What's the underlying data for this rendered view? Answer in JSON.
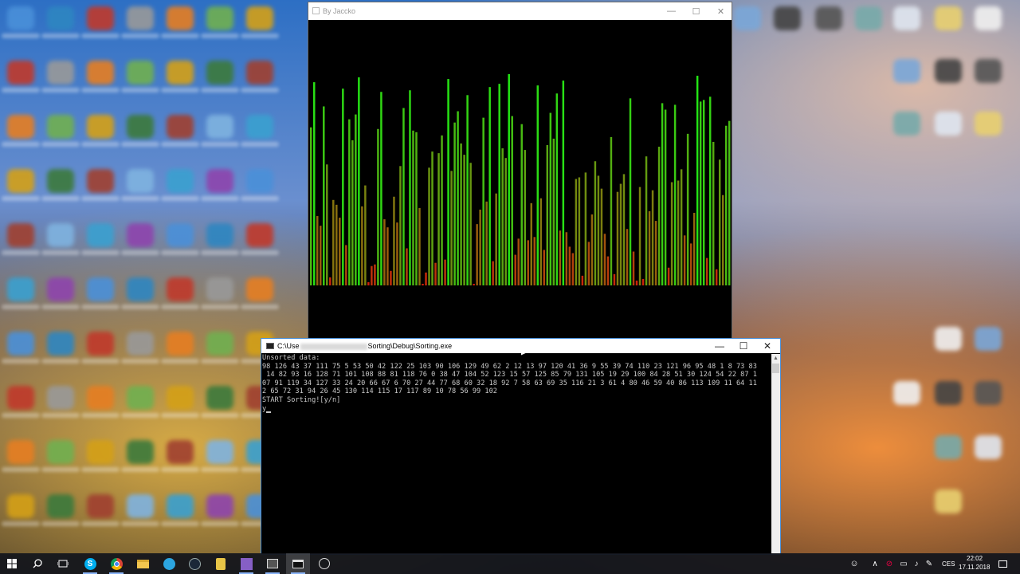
{
  "viz_window": {
    "title": "By Jaccko",
    "values": [
      98,
      126,
      43,
      37,
      111,
      75,
      5,
      53,
      50,
      42,
      122,
      25,
      103,
      90,
      106,
      129,
      49,
      62,
      2,
      12,
      13,
      97,
      120,
      41,
      36,
      9,
      55,
      39,
      74,
      110,
      23,
      121,
      96,
      95,
      48,
      1,
      8,
      73,
      83,
      14,
      82,
      93,
      16,
      128,
      71,
      101,
      108,
      88,
      81,
      118,
      76,
      0,
      38,
      47,
      104,
      52,
      123,
      15,
      57,
      125,
      85,
      79,
      131,
      105,
      19,
      29,
      100,
      84,
      28,
      51,
      30,
      124,
      54,
      22,
      87,
      107,
      91,
      119,
      34,
      127,
      33,
      24,
      20,
      66,
      67,
      6,
      70,
      27,
      44,
      77,
      68,
      60,
      32,
      18,
      92,
      7,
      58,
      63,
      69,
      35,
      116,
      21,
      3,
      61,
      4,
      80,
      46,
      59,
      40,
      86,
      113,
      109,
      11,
      64,
      112,
      65,
      72,
      31,
      94,
      26,
      45,
      130,
      114,
      115,
      17,
      117,
      89,
      10,
      78,
      56,
      99,
      102
    ],
    "colors": {
      "high": "#22e614",
      "low": "#d41a0a",
      "background": "#000000"
    }
  },
  "console_window": {
    "title_prefix": "C:\\Use",
    "title_suffix": "Sorting\\Debug\\Sorting.exe",
    "lines": [
      "Unsorted data:",
      "98 126 43 37 111 75 5 53 50 42 122 25 103 90 106 129 49 62 2 12 13 97 120 41 36 9 55 39 74 110 23 121 96 95 48 1 8 73 83",
      " 14 82 93 16 128 71 101 108 88 81 118 76 0 38 47 104 52 123 15 57 125 85 79 131 105 19 29 100 84 28 51 30 124 54 22 87 1",
      "07 91 119 34 127 33 24 20 66 67 6 70 27 44 77 68 60 32 18 92 7 58 63 69 35 116 21 3 61 4 80 46 59 40 86 113 109 11 64 11",
      "2 65 72 31 94 26 45 130 114 115 17 117 89 10 78 56 99 102",
      "START Sorting![y/n]"
    ],
    "input": "y"
  },
  "window_controls": {
    "minimize": "—",
    "maximize": "☐",
    "close": "✕"
  },
  "taskbar": {
    "language": "CES",
    "time": "22:02",
    "date": "17.11.2018"
  }
}
